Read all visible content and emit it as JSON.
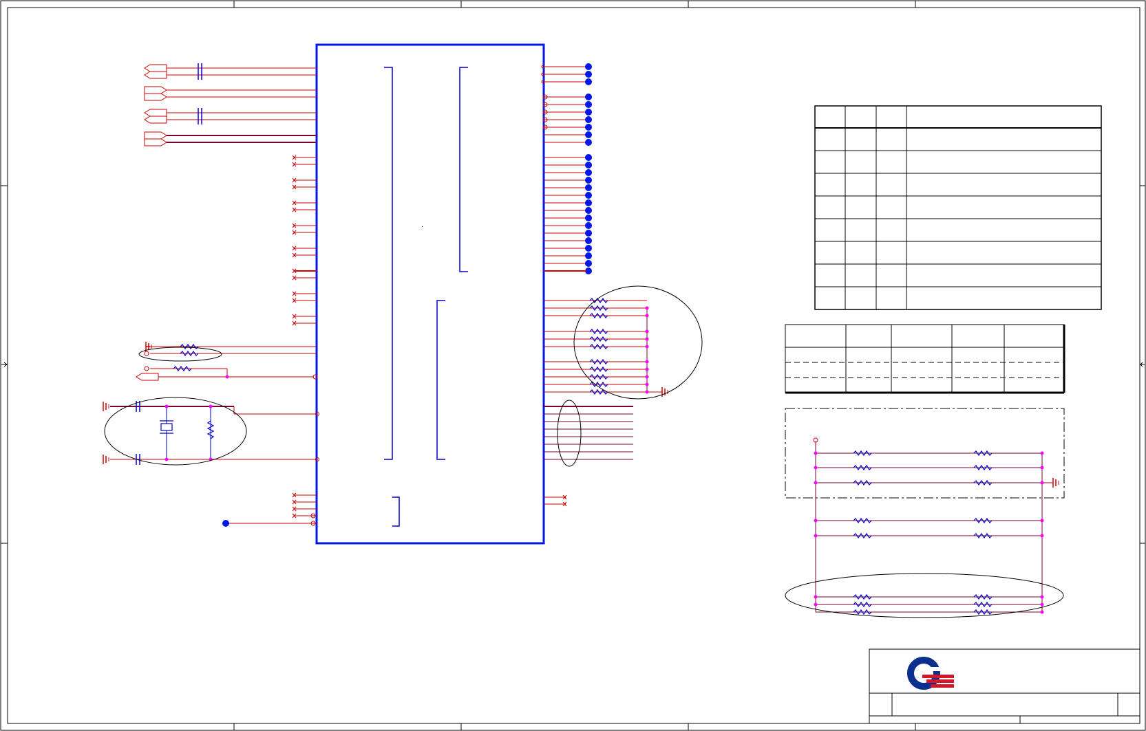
{
  "sheet": {
    "title": "",
    "zone_marks": [],
    "border_color": "#000000"
  },
  "colors": {
    "net_wire": "#cc0000",
    "component": "#0000cc",
    "ic_outline": "#0018e6",
    "junction_magenta": "#ff00ff",
    "bus_wire": "#7a0030",
    "annotation_ellipse": "#000000",
    "logo_blue": "#0a2f8c",
    "logo_red": "#d2182a"
  },
  "main_ic": {
    "reference": "",
    "part_name": "",
    "visible_text": "."
  },
  "resistor_table": {
    "headers": [],
    "rows": []
  },
  "config_table": {
    "headers": [],
    "rows": []
  },
  "pull_resistor_block": {
    "label": ""
  },
  "title_block": {
    "company": "",
    "title": "",
    "size": "",
    "document_number": "",
    "rev": "",
    "date": "",
    "sheet": "",
    "logo": "quanta-logo"
  }
}
